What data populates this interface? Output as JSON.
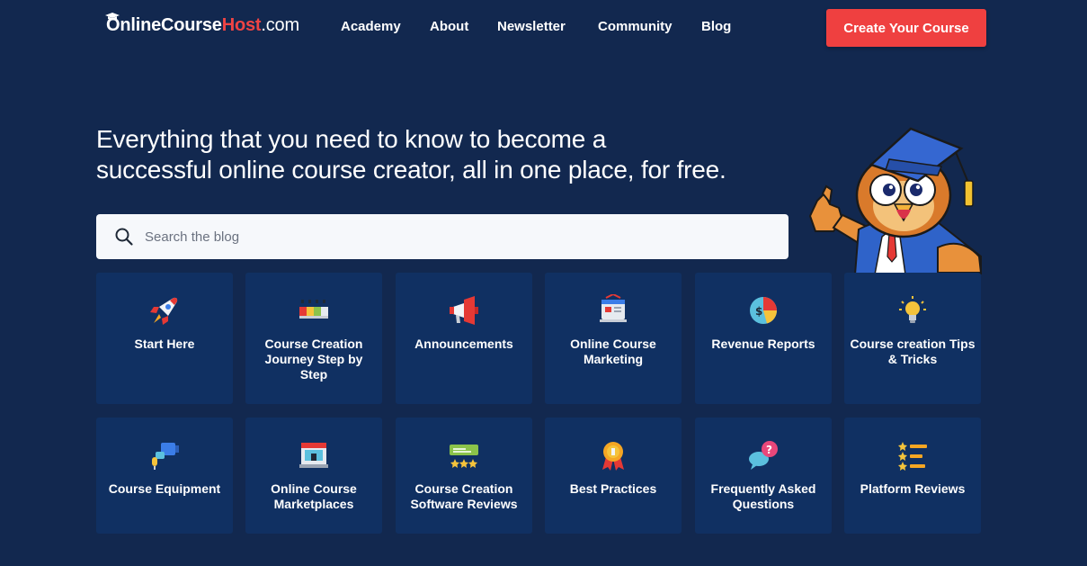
{
  "header": {
    "logo": {
      "part1": "OnlineCourse",
      "part2": "Host",
      "part3": ".com"
    },
    "nav": [
      {
        "label": "Academy"
      },
      {
        "label": "About"
      },
      {
        "label": "Newsletter"
      },
      {
        "label": "Community"
      },
      {
        "label": "Blog"
      }
    ],
    "cta_label": "Create Your Course"
  },
  "hero": {
    "title_line1": "Everything that you need to know to become a",
    "title_line2": "successful online course creator, all in one place, for free."
  },
  "search": {
    "placeholder": "Search the blog"
  },
  "categories": [
    {
      "label": "Start Here",
      "icon": "rocket-icon"
    },
    {
      "label": "Course Creation Journey Step by Step",
      "icon": "progress-bar-icon"
    },
    {
      "label": "Announcements",
      "icon": "megaphone-icon"
    },
    {
      "label": "Online Course Marketing",
      "icon": "marketing-board-icon"
    },
    {
      "label": "Revenue Reports",
      "icon": "pie-chart-dollar-icon"
    },
    {
      "label": "Course creation Tips & Tricks",
      "icon": "lightbulb-icon"
    },
    {
      "label": "Course Equipment",
      "icon": "microphone-camera-icon"
    },
    {
      "label": "Online Course Marketplaces",
      "icon": "storefront-icon"
    },
    {
      "label": "Course Creation Software Reviews",
      "icon": "star-rating-icon"
    },
    {
      "label": "Best Practices",
      "icon": "award-medal-icon"
    },
    {
      "label": "Frequently Asked Questions",
      "icon": "chat-question-icon"
    },
    {
      "label": "Platform Reviews",
      "icon": "star-list-icon"
    }
  ],
  "colors": {
    "background": "#12284f",
    "card": "#103062",
    "accent": "#ef4040",
    "search_bg": "#f6f8fb"
  }
}
